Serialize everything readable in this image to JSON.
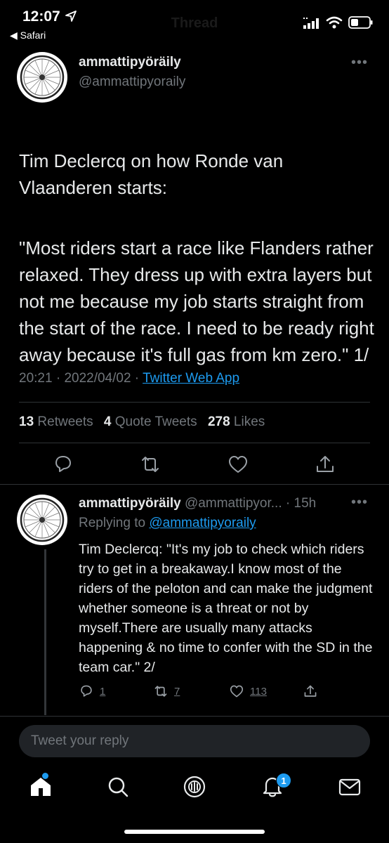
{
  "status_bar": {
    "time": "12:07",
    "back_app": "◀ Safari"
  },
  "header": {
    "title": "Thread"
  },
  "main_tweet": {
    "author_name": "ammattipyöräily",
    "author_handle": "@ammattipyoraily",
    "more": "•••",
    "text_p1": "Tim Declercq on how Ronde van Vlaanderen starts:",
    "text_p2": "\"Most riders start a race like Flanders rather relaxed. They dress up with extra layers but not me because my job starts straight from the start of the race. I need to be ready right away because it's full gas from km zero.\" 1/",
    "time": "20:21",
    "date": "2022/04/02",
    "source": "Twitter Web App",
    "retweets_count": "13",
    "retweets_label": "Retweets",
    "quotes_count": "4",
    "quotes_label": "Quote Tweets",
    "likes_count": "278",
    "likes_label": "Likes"
  },
  "reply_tweet": {
    "author_name": "ammattipyöräily",
    "author_handle": "@ammattipyor...",
    "age": "· 15h",
    "more": "•••",
    "replying_label": "Replying to",
    "replying_handle": "@ammattipyoraily",
    "text": "Tim Declercq: \"It's my job to check which riders try to get in a breakaway.I know most of the riders of the peloton and can make the judgment whether someone is a threat or not by myself.There are usually many attacks happening & no time to confer with the SD in the team car.\" 2/",
    "replies": "1",
    "retweets": "7",
    "likes": "113"
  },
  "composer": {
    "placeholder": "Tweet your reply"
  },
  "nav": {
    "notifications_badge": "1",
    "icons": [
      "home-icon",
      "search-icon",
      "spaces-icon",
      "notifications-icon",
      "messages-icon"
    ]
  },
  "colors": {
    "background": "#000000",
    "text": "#e7e9ea",
    "secondary": "#71767b",
    "accent": "#1d9bf0",
    "divider": "#2f3336"
  }
}
